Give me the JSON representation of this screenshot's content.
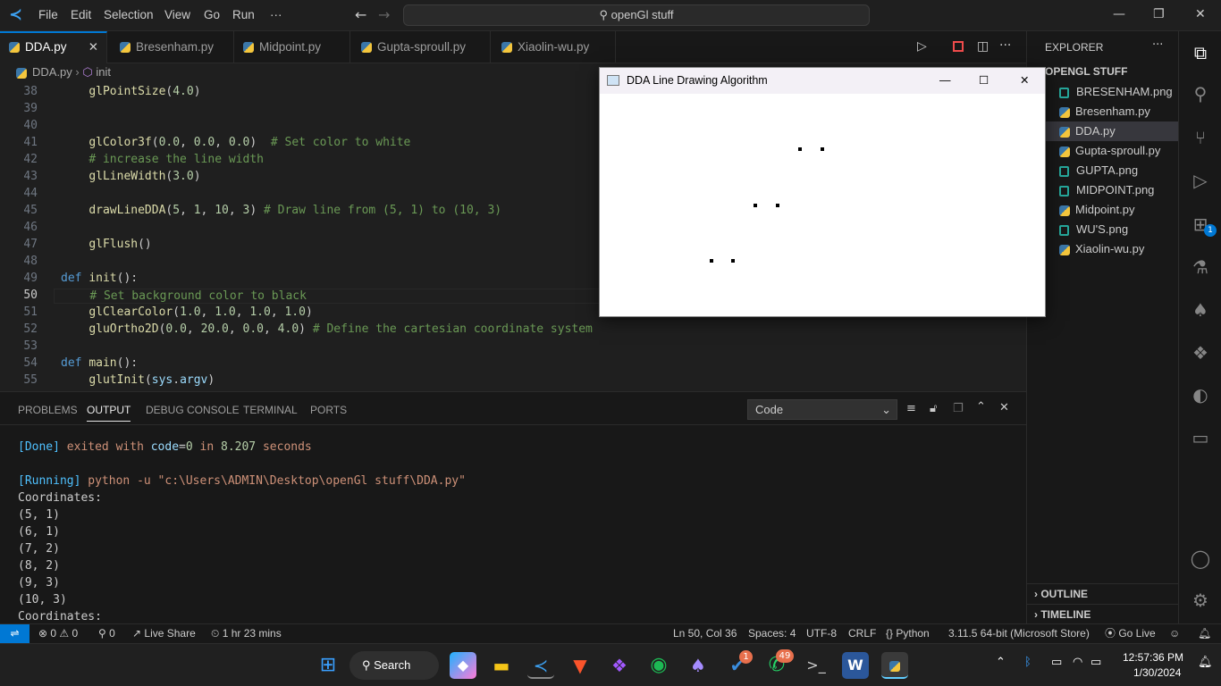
{
  "titlebar": {
    "menus": [
      "File",
      "Edit",
      "Selection",
      "View",
      "Go",
      "Run",
      "···"
    ],
    "search": "openGl stuff"
  },
  "tabs": [
    {
      "label": "DDA.py",
      "active": true
    },
    {
      "label": "Bresenham.py"
    },
    {
      "label": "Midpoint.py"
    },
    {
      "label": "Gupta-sproull.py"
    },
    {
      "label": "Xiaolin-wu.py"
    }
  ],
  "breadcrumb": {
    "file": "DDA.py",
    "symbol": "init"
  },
  "editor": {
    "lines": [
      {
        "n": "38",
        "html": "    <span class='fn'>glPointSize</span>(<span class='num'>4.0</span>)"
      },
      {
        "n": "39",
        "html": ""
      },
      {
        "n": "40",
        "html": ""
      },
      {
        "n": "41",
        "html": "    <span class='fn'>glColor3f</span>(<span class='num'>0.0</span>, <span class='num'>0.0</span>, <span class='num'>0.0</span>)  <span class='cm'># Set color to white</span>"
      },
      {
        "n": "42",
        "html": "    <span class='cm'># increase the line width</span>"
      },
      {
        "n": "43",
        "html": "    <span class='fn'>glLineWidth</span>(<span class='num'>3.0</span>)"
      },
      {
        "n": "44",
        "html": ""
      },
      {
        "n": "45",
        "html": "    <span class='fn'>drawLineDDA</span>(<span class='num'>5</span>, <span class='num'>1</span>, <span class='num'>10</span>, <span class='num'>3</span>) <span class='cm'># Draw line from (5, 1) to (10, 3)</span>"
      },
      {
        "n": "46",
        "html": ""
      },
      {
        "n": "47",
        "html": "    <span class='fn'>glFlush</span>()"
      },
      {
        "n": "48",
        "html": ""
      },
      {
        "n": "49",
        "html": "<span class='kw'>def</span> <span class='fn'>init</span>():"
      },
      {
        "n": "50",
        "html": "    <span class='cm'># Set background color to black</span>"
      },
      {
        "n": "51",
        "html": "    <span class='fn'>glClearColor</span>(<span class='num'>1.0</span>, <span class='num'>1.0</span>, <span class='num'>1.0</span>, <span class='num'>1.0</span>)"
      },
      {
        "n": "52",
        "html": "    <span class='fn'>gluOrtho2D</span>(<span class='num'>0.0</span>, <span class='num'>20.0</span>, <span class='num'>0.0</span>, <span class='num'>4.0</span>) <span class='cm'># Define the cartesian coordinate system</span>"
      },
      {
        "n": "53",
        "html": ""
      },
      {
        "n": "54",
        "html": "<span class='kw'>def</span> <span class='fn'>main</span>():"
      },
      {
        "n": "55",
        "html": "    <span class='fn'>glutInit</span>(<span class='var'>sys</span>.<span class='var'>argv</span>)"
      }
    ]
  },
  "panel": {
    "tabs": [
      "PROBLEMS",
      "OUTPUT",
      "DEBUG CONSOLE",
      "TERMINAL",
      "PORTS"
    ],
    "active": "OUTPUT",
    "channel": "Code",
    "output": [
      "[Done] exited with code=0 in 8.207 seconds",
      "",
      "[Running] python -u \"c:\\Users\\ADMIN\\Desktop\\openGl stuff\\DDA.py\"",
      "Coordinates:",
      "(5, 1)",
      "(6, 1)",
      "(7, 2)",
      "(8, 2)",
      "(9, 3)",
      "(10, 3)",
      "Coordinates:"
    ]
  },
  "explorer": {
    "header": "EXPLORER",
    "folder": "OPENGL STUFF",
    "files": [
      {
        "name": "BRESENHAM.png",
        "type": "img"
      },
      {
        "name": "Bresenham.py",
        "type": "py"
      },
      {
        "name": "DDA.py",
        "type": "py",
        "selected": true
      },
      {
        "name": "Gupta-sproull.py",
        "type": "py"
      },
      {
        "name": "GUPTA.png",
        "type": "img"
      },
      {
        "name": "MIDPOINT.png",
        "type": "img"
      },
      {
        "name": "Midpoint.py",
        "type": "py"
      },
      {
        "name": "WU'S.png",
        "type": "img"
      },
      {
        "name": "Xiaolin-wu.py",
        "type": "py"
      }
    ],
    "outline": "OUTLINE",
    "timeline": "TIMELINE"
  },
  "glwindow": {
    "title": "DDA Line Drawing Algorithm",
    "points": [
      [
        5,
        1
      ],
      [
        6,
        1
      ],
      [
        7,
        2
      ],
      [
        8,
        2
      ],
      [
        9,
        3
      ],
      [
        10,
        3
      ]
    ],
    "ortho": [
      0,
      20,
      0,
      4
    ]
  },
  "status": {
    "errors": "0",
    "warnings": "0",
    "ports": "0",
    "liveshare": "Live Share",
    "time": "1 hr 23 mins",
    "cursor": "Ln 50, Col 36",
    "spaces": "Spaces: 4",
    "encoding": "UTF-8",
    "eol": "CRLF",
    "lang": "Python",
    "interpreter": "3.11.5 64-bit (Microsoft Store)",
    "golive": "Go Live"
  },
  "taskbar": {
    "search": "Search",
    "time": "12:57:36 PM",
    "date": "1/30/2024",
    "badge_teams": "1",
    "badge_whatsapp": "49"
  }
}
